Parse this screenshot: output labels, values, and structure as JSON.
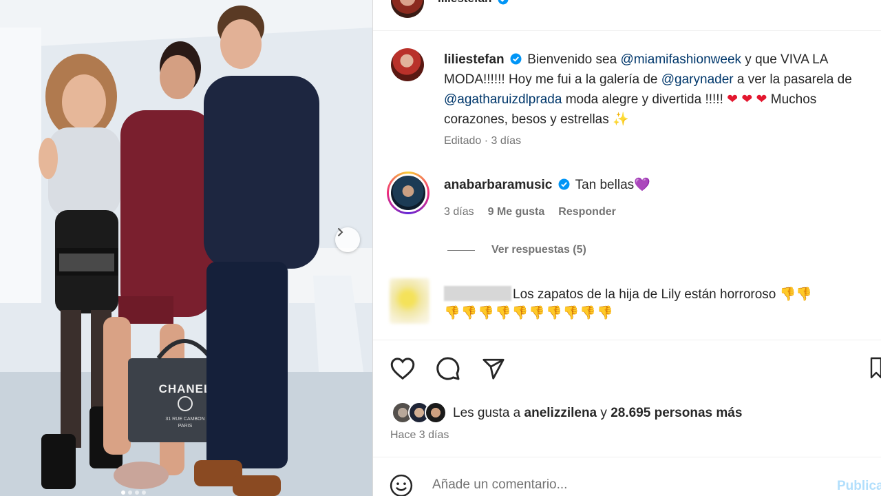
{
  "post": {
    "author": "liliestefan",
    "caption": {
      "username": "liliestefan",
      "text1": "Bienvenido sea",
      "mention1": "@miamifashionweek",
      "text2": "y que VIVA LA MODA!!!!!! Hoy me fui a la galería de",
      "mention2": "@garynader",
      "text3": "a ver la pasarela de",
      "mention3": "@agatharuizdlprada",
      "text4": "moda alegre y divertida !!!!!",
      "heart": "❤",
      "text5": "Muchos corazones, besos y estrellas",
      "sparkles": "✨"
    },
    "edited": "Editado",
    "edited_time": "3 días",
    "bag_text": {
      "brand": "CHANEL",
      "address": "31 RUE CAMBON",
      "city": "PARIS"
    }
  },
  "comments": [
    {
      "username": "anabarbaramusic",
      "text": "Tan bellas",
      "emoji": "💜",
      "time": "3 días",
      "likes": "9 Me gusta",
      "reply": "Responder",
      "view_replies": "Ver respuestas (5)"
    },
    {
      "username": "",
      "text": "Los zapatos de la hija de Lily están horroroso",
      "thumbs_down": "👎"
    }
  ],
  "likes": {
    "prefix": "Les gusta a",
    "user": "anelizzilena",
    "middle": "y",
    "count": "28.695 personas más"
  },
  "posted": "Hace 3 días",
  "input": {
    "placeholder": "Añade un comentario...",
    "publish": "Publicar"
  },
  "icons": [
    "heart-icon",
    "comment-icon",
    "share-icon",
    "bookmark-icon",
    "emoji-icon",
    "chevron-right-icon",
    "verified-icon"
  ],
  "colors": {
    "mention": "#00376b",
    "verified": "#0095f6",
    "publish_disabled": "#b2dffc",
    "meta": "#737373"
  }
}
